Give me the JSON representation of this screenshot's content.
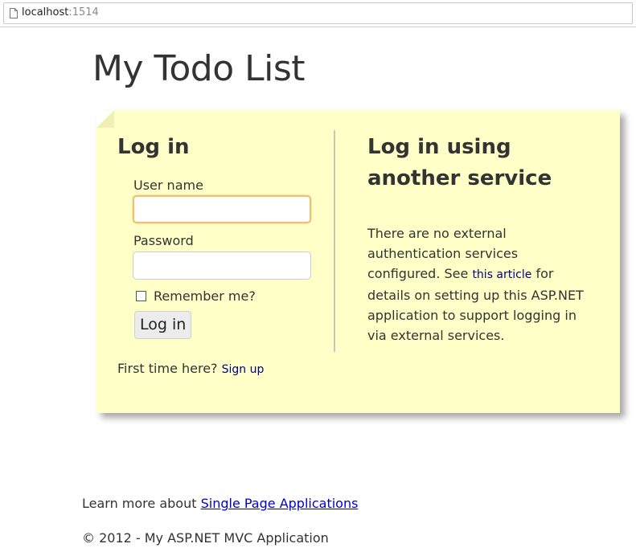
{
  "browser": {
    "url_host": "localhost",
    "url_port": ":1514"
  },
  "page": {
    "title": "My Todo List"
  },
  "login": {
    "heading": "Log in",
    "username_label": "User name",
    "username_value": "",
    "password_label": "Password",
    "password_value": "",
    "remember_label": "Remember me?",
    "remember_checked": false,
    "button_label": "Log in",
    "first_time_text": "First time here?",
    "signup_link": "Sign up"
  },
  "external": {
    "heading": "Log in using another service",
    "text_before_link": "There are no external authentication services configured. See ",
    "link_text": "this article",
    "text_after_link": " for details on setting up this ASP.NET application to support logging in via external services."
  },
  "footer": {
    "learn_more_text": "Learn more about ",
    "learn_more_link": "Single Page Applications",
    "copyright": "© 2012 - My ASP.NET MVC Application"
  },
  "colors": {
    "note_background": "#ffffc8",
    "focus_border": "#f0c070",
    "link_color": "#000080"
  },
  "icons": {
    "page_icon": "page-icon"
  }
}
